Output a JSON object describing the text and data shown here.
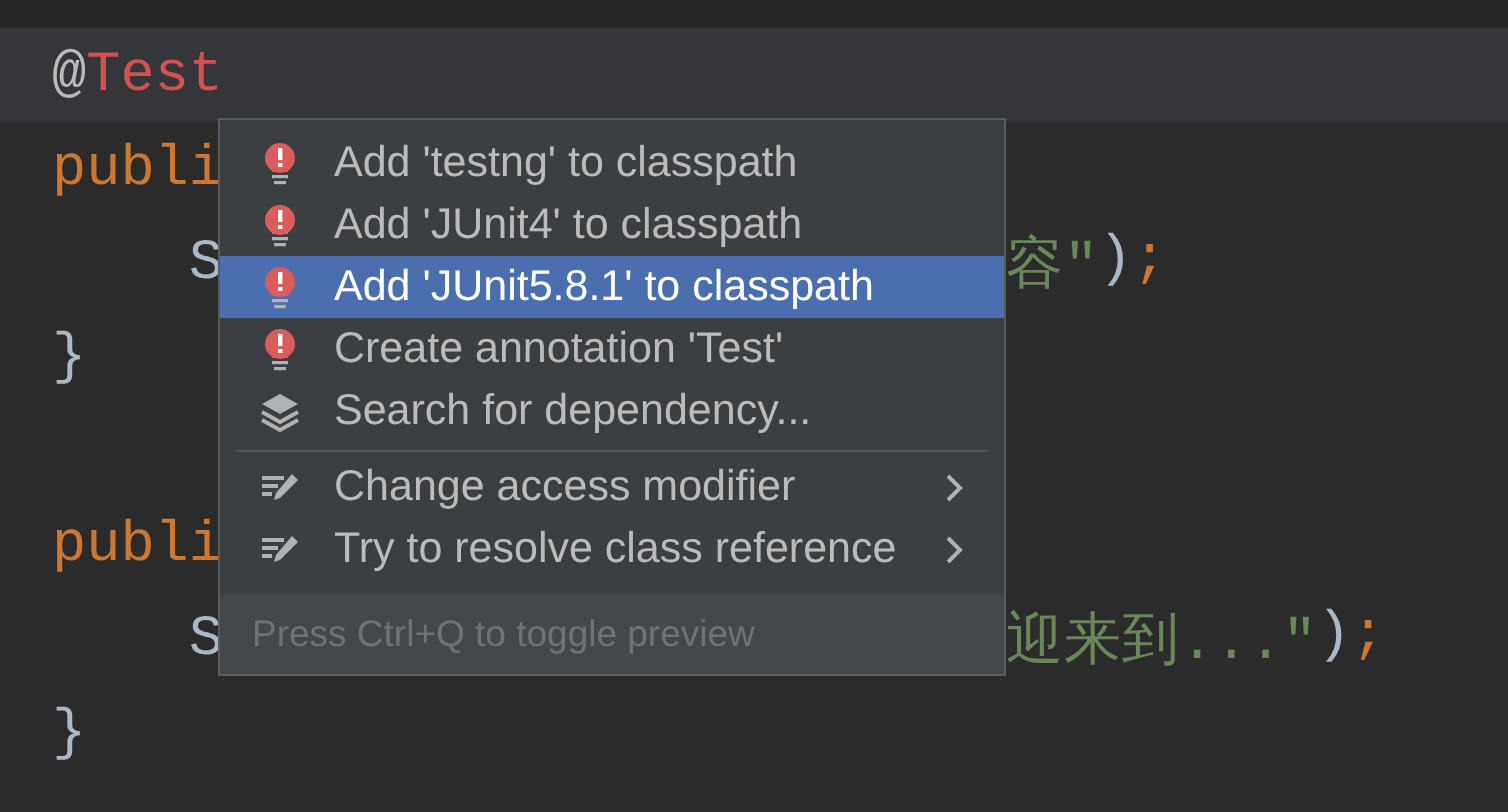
{
  "editor": {
    "lines": [
      {
        "current": true,
        "left": [
          {
            "kind": "annotation",
            "text": "@"
          },
          {
            "kind": "annotation_name",
            "text": "Test"
          }
        ]
      },
      {
        "current": false,
        "left": [
          {
            "kind": "keyword",
            "text": "publi"
          }
        ]
      },
      {
        "current": false,
        "left": [
          {
            "kind": "plain",
            "text": "    S"
          }
        ],
        "right": [
          {
            "kind": "string",
            "text": "容\""
          },
          {
            "kind": "plain",
            "text": ")"
          },
          {
            "kind": "keyword",
            "text": ";"
          }
        ]
      },
      {
        "current": false,
        "left": [
          {
            "kind": "plain",
            "text": "}"
          }
        ]
      },
      {
        "current": false
      },
      {
        "current": false,
        "left": [
          {
            "kind": "keyword",
            "text": "publi"
          }
        ]
      },
      {
        "current": false,
        "left": [
          {
            "kind": "plain",
            "text": "    S"
          }
        ],
        "right": [
          {
            "kind": "string",
            "text": "迎来到...\""
          },
          {
            "kind": "plain",
            "text": ")"
          },
          {
            "kind": "keyword",
            "text": ";"
          }
        ]
      },
      {
        "current": false,
        "left": [
          {
            "kind": "plain",
            "text": "}"
          }
        ]
      }
    ]
  },
  "popup": {
    "sections": [
      [
        {
          "kind": "quickfix",
          "label": "Add 'testng' to classpath",
          "selected": false,
          "has_submenu": false
        },
        {
          "kind": "quickfix",
          "label": "Add 'JUnit4' to classpath",
          "selected": false,
          "has_submenu": false
        },
        {
          "kind": "quickfix",
          "label": "Add 'JUnit5.8.1' to classpath",
          "selected": true,
          "has_submenu": false
        },
        {
          "kind": "quickfix",
          "label": "Create annotation 'Test'",
          "selected": false,
          "has_submenu": false
        },
        {
          "kind": "search",
          "label": "Search for dependency...",
          "selected": false,
          "has_submenu": false
        }
      ],
      [
        {
          "kind": "intention",
          "label": "Change access modifier",
          "selected": false,
          "has_submenu": true
        },
        {
          "kind": "intention",
          "label": "Try to resolve class reference",
          "selected": false,
          "has_submenu": true
        }
      ]
    ],
    "hint": "Press Ctrl+Q to toggle preview"
  }
}
